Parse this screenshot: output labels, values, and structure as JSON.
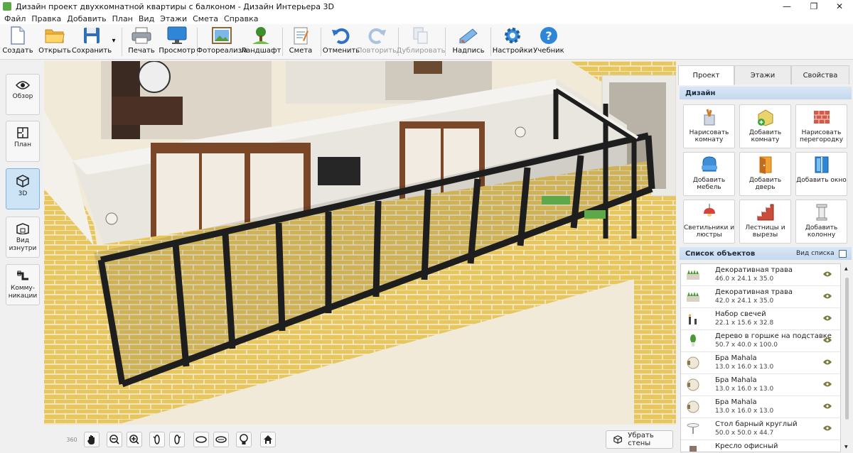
{
  "window": {
    "title": "Дизайн проект двухкомнатной квартиры с балконом - Дизайн Интерьера 3D",
    "minimize": "—",
    "maximize": "❐",
    "close": "✕"
  },
  "menu": [
    "Файл",
    "Правка",
    "Добавить",
    "План",
    "Вид",
    "Этажи",
    "Смета",
    "Справка"
  ],
  "toolbar": {
    "create": "Создать",
    "open": "Открыть",
    "save": "Сохранить",
    "save_dropdown": "▾",
    "print": "Печать",
    "preview": "Просмотр",
    "photorealism": "Фотореализм",
    "landscape": "Ландшафт",
    "estimate": "Смета",
    "undo": "Отменить",
    "redo": "Повторить",
    "duplicate": "Дублировать",
    "label": "Надпись",
    "settings": "Настройки",
    "tutorial": "Учебник"
  },
  "left_panel": {
    "overview": "Обзор",
    "plan": "План",
    "view3d": "3D",
    "inside": "Вид изнутри",
    "utilities": "Комму-\nникации",
    "active": "3D"
  },
  "viewport_bar": {
    "remove_walls": "Убрать стены",
    "rotate_360": "360"
  },
  "right_panel": {
    "tabs": [
      "Проект",
      "Этажи",
      "Свойства"
    ],
    "active_tab": "Проект",
    "design_header": "Дизайн",
    "design_buttons": [
      {
        "label": "Нарисовать комнату",
        "icon": "paint-brush-icon"
      },
      {
        "label": "Добавить комнату",
        "icon": "add-room-icon"
      },
      {
        "label": "Нарисовать перегородку",
        "icon": "brick-wall-icon"
      },
      {
        "label": "Добавить мебель",
        "icon": "armchair-icon"
      },
      {
        "label": "Добавить дверь",
        "icon": "door-icon"
      },
      {
        "label": "Добавить окно",
        "icon": "window-icon"
      },
      {
        "label": "Светильники и люстры",
        "icon": "lamp-icon"
      },
      {
        "label": "Лестницы и вырезы",
        "icon": "stairs-icon"
      },
      {
        "label": "Добавить колонну",
        "icon": "column-icon"
      }
    ],
    "objects_header": "Список объектов",
    "view_list": "Вид списка",
    "objects": [
      {
        "name": "Декоративная трава",
        "dims": "46.0 x 24.1 x 35.0",
        "icon": "grass-icon"
      },
      {
        "name": "Декоративная трава",
        "dims": "42.0 x 24.1 x 35.0",
        "icon": "grass-icon"
      },
      {
        "name": "Набор свечей",
        "dims": "22.1 x 15.6 x 32.8",
        "icon": "candles-icon"
      },
      {
        "name": "Дерево в горшке на подставке",
        "dims": "50.7 x 40.0 x 100.0",
        "icon": "plant-icon"
      },
      {
        "name": "Бра Mahala",
        "dims": "13.0 x 16.0 x 13.0",
        "icon": "sconce-icon"
      },
      {
        "name": "Бра Mahala",
        "dims": "13.0 x 16.0 x 13.0",
        "icon": "sconce-icon"
      },
      {
        "name": "Бра Mahala",
        "dims": "13.0 x 16.0 x 13.0",
        "icon": "sconce-icon"
      },
      {
        "name": "Стол барный круглый",
        "dims": "50.0 x 50.0 x 44.7",
        "icon": "table-icon"
      },
      {
        "name": "Кресло офисный",
        "dims": "",
        "icon": "chair-icon"
      }
    ]
  },
  "colors": {
    "accent": "#2f7bd1",
    "brick": "#e8c45c",
    "frame": "#1e1e1e"
  }
}
